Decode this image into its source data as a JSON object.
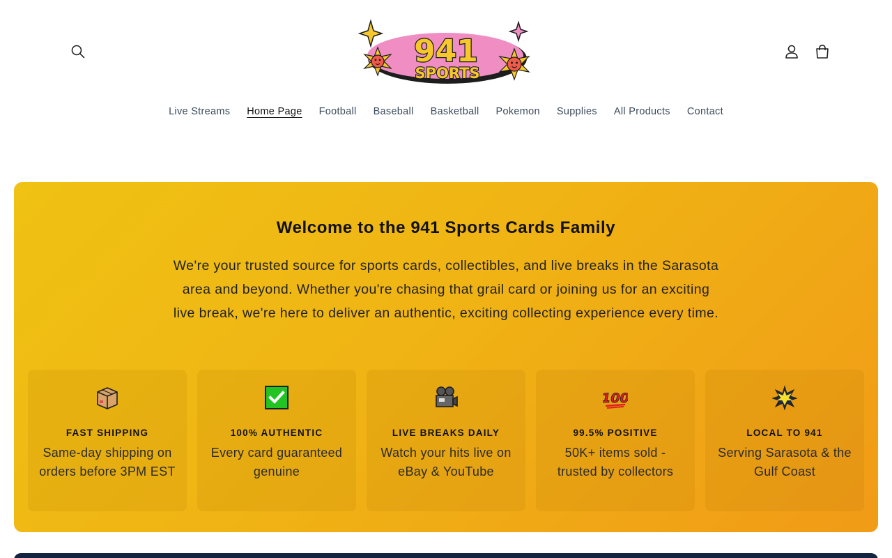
{
  "header": {
    "logo": {
      "top": "941",
      "bottom": "SPORTS"
    },
    "icons": {
      "search": "search-icon",
      "account": "account-icon",
      "cart": "cart-icon"
    }
  },
  "nav": {
    "items": [
      {
        "label": "Live Streams"
      },
      {
        "label": "Home Page"
      },
      {
        "label": "Football"
      },
      {
        "label": "Baseball"
      },
      {
        "label": "Basketball"
      },
      {
        "label": "Pokemon"
      },
      {
        "label": "Supplies"
      },
      {
        "label": "All Products"
      },
      {
        "label": "Contact"
      }
    ],
    "active": "Home Page"
  },
  "hero": {
    "title": "Welcome to the 941 Sports Cards Family",
    "text": "We're your trusted source for sports cards, collectibles, and live breaks in the Sarasota area and beyond. Whether you're chasing that grail card or joining us for an exciting live break, we're here to deliver an authentic, exciting collecting experience every time.",
    "features": [
      {
        "icon": "package-icon",
        "title": "FAST SHIPPING",
        "desc": "Same-day shipping on orders before 3PM EST"
      },
      {
        "icon": "checkmark-icon",
        "title": "100% AUTHENTIC",
        "desc": "Every card guaranteed genuine"
      },
      {
        "icon": "video-camera-icon",
        "title": "LIVE BREAKS DAILY",
        "desc": "Watch your hits live on eBay & YouTube"
      },
      {
        "icon": "hundred-points-icon",
        "title": "99.5% POSITIVE",
        "desc": "50K+ items sold - trusted by collectors"
      },
      {
        "icon": "star-burst-icon",
        "title": "LOCAL TO 941",
        "desc": "Serving Sarasota & the Gulf Coast"
      }
    ]
  },
  "colors": {
    "hero_start": "#efc213",
    "hero_end": "#f19b17",
    "logo_pink": "#f08ec4",
    "logo_yellow": "#f7c82b",
    "footer_band": "#14233f"
  }
}
